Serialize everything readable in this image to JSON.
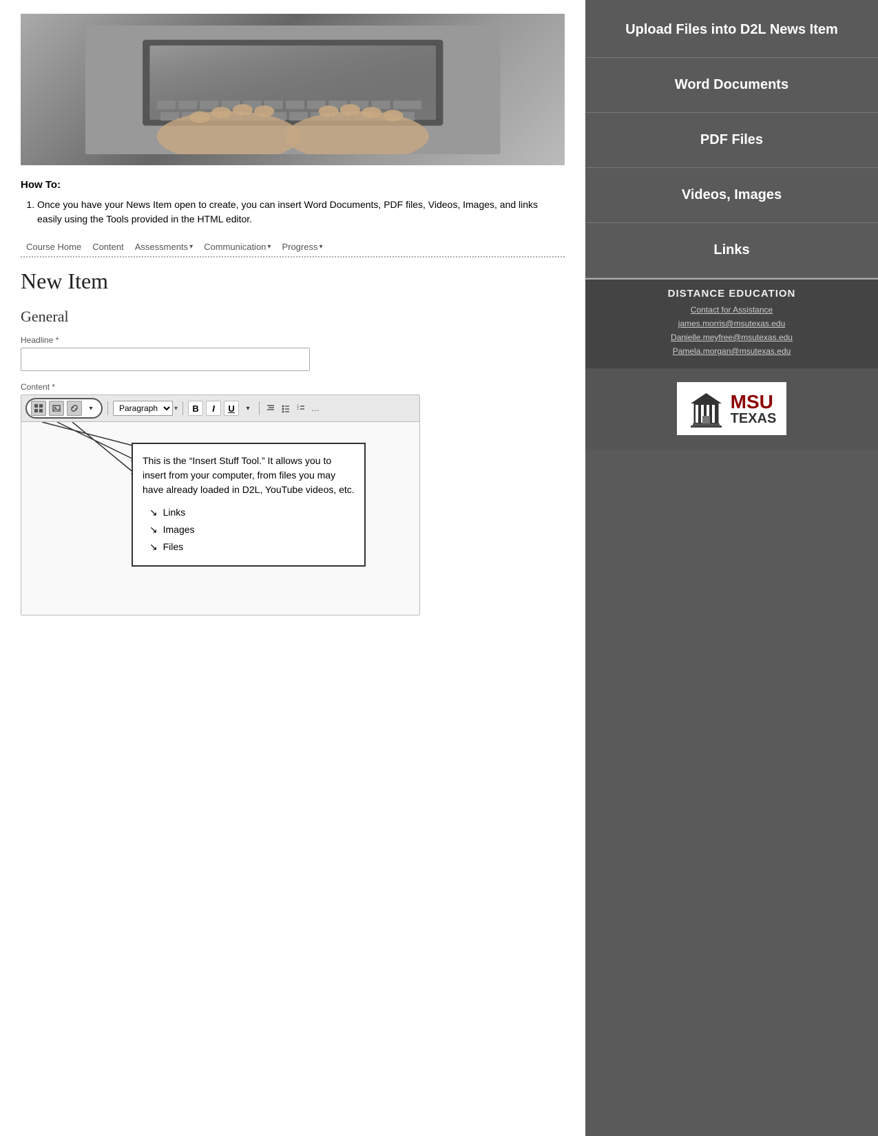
{
  "hero": {
    "alt": "Hands typing on a laptop keyboard"
  },
  "howTo": {
    "title": "How To:",
    "steps": [
      "Once you have your News Item open to create, you can insert Word Documents, PDF files, Videos, Images, and links easily using the Tools provided in the HTML editor."
    ]
  },
  "nav": {
    "items": [
      {
        "label": "Course Home",
        "hasDropdown": false
      },
      {
        "label": "Content",
        "hasDropdown": false
      },
      {
        "label": "Assessments",
        "hasDropdown": true
      },
      {
        "label": "Communication",
        "hasDropdown": true
      },
      {
        "label": "Progress",
        "hasDropdown": true
      }
    ]
  },
  "page": {
    "title": "New Item",
    "sectionTitle": "General",
    "headline_label": "Headline *",
    "content_label": "Content *"
  },
  "toolbar": {
    "paragraph_option": "Paragraph",
    "bold": "B",
    "italic": "I",
    "underline": "U",
    "dropdown_arrow": "▾"
  },
  "callout": {
    "body": "This is the “Insert Stuff Tool.” It allows you to insert from your computer, from files you may have already loaded in D2L, YouTube videos, etc.",
    "items": [
      "Links",
      "Images",
      "Files"
    ]
  },
  "sidebar": {
    "nav_items": [
      "Upload Files into D2L News Item",
      "Word Documents",
      "PDF Files",
      "Videos, Images",
      "Links"
    ],
    "distance": {
      "title": "DISTANCE EDUCATION",
      "contact_label": "Contact for Assistance",
      "emails": [
        "james.morris@msutexas.edu",
        "Danielle.meyfree@msutexas.edu",
        "Pamela.morgan@msutexas.edu"
      ]
    },
    "logo": {
      "msu": "MSU",
      "texas": "TEXAS"
    }
  }
}
